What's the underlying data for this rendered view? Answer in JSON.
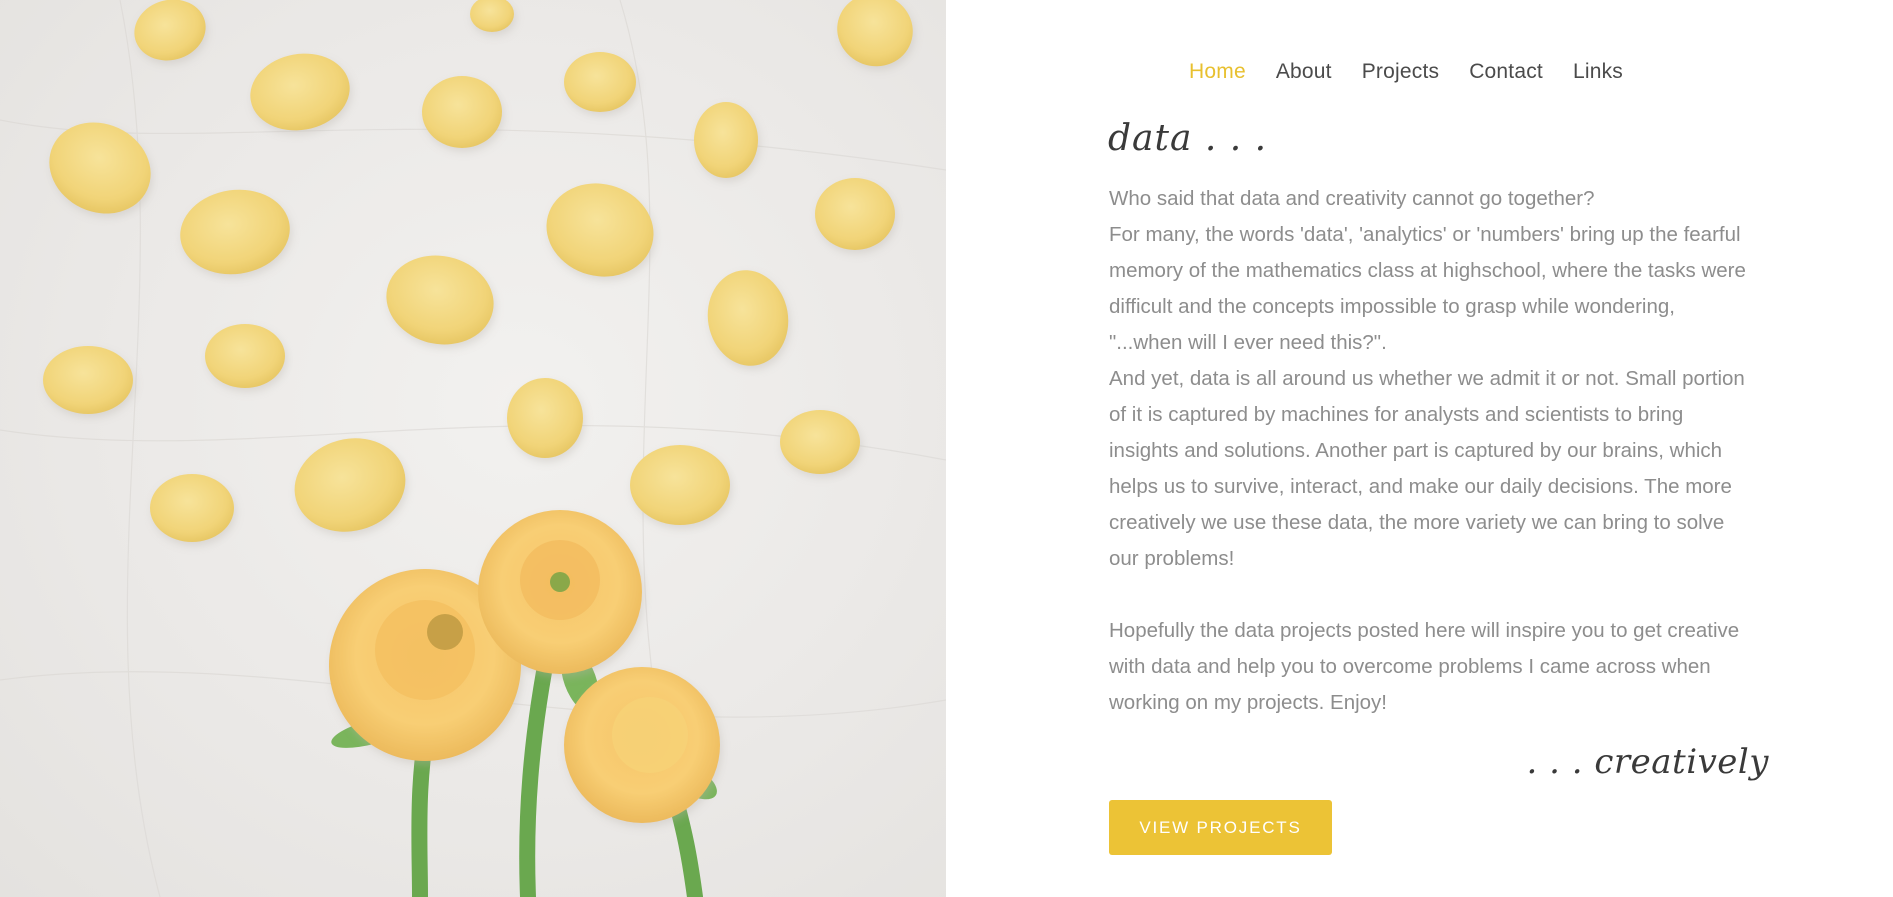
{
  "nav": {
    "items": [
      {
        "label": "Home",
        "active": true
      },
      {
        "label": "About",
        "active": false
      },
      {
        "label": "Projects",
        "active": false
      },
      {
        "label": "Contact",
        "active": false
      },
      {
        "label": "Links",
        "active": false
      }
    ]
  },
  "hero": {
    "image": "yellow-petals-and-ranunculus-flowers-photo"
  },
  "main": {
    "heading_top": "data . . .",
    "paragraphs": [
      "Who said that data and creativity cannot go together?",
      "For many, the words 'data', 'analytics' or 'numbers' bring up the fearful memory of the mathematics class at highschool, where the tasks were difficult and the concepts impossible to grasp while wondering, \"...when will I ever need this?\".",
      "And yet, data is all around us whether we admit it or not. Small portion of it is captured by machines for analysts and scientists to bring insights and solutions. Another part is captured by our brains, which helps us to survive, interact, and make our daily decisions. The more creatively we use these data, the more variety we can bring to solve our problems!",
      "Hopefully the data projects posted here will inspire you to get creative with data and help you to overcome problems I came across when working on my projects. Enjoy!"
    ],
    "heading_bottom": ". . . creatively",
    "cta_label": "VIEW PROJECTS"
  },
  "colors": {
    "accent": "#ecc336",
    "nav_active": "#e8c02f",
    "text": "#8d8d8d",
    "heading": "#3a3a3a"
  }
}
